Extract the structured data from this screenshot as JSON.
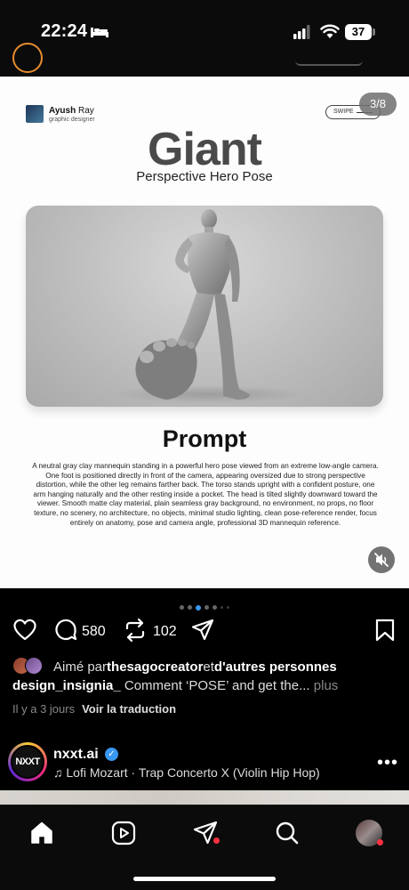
{
  "status_bar": {
    "time": "22:24",
    "battery": "37"
  },
  "slide": {
    "counter": "3/8",
    "author_first": "Ayush",
    "author_last": " Ray",
    "author_role": "graphic designer",
    "swipe_label": "SWIPE",
    "title": "Giant",
    "subtitle": "Perspective Hero Pose",
    "prompt_heading": "Prompt",
    "prompt_text": "A neutral gray clay mannequin standing in a powerful hero pose viewed from an extreme low-angle camera. One foot is positioned directly in front of the camera, appearing oversized due to strong perspective distortion, while the other leg remains farther back. The torso stands upright with a confident posture, one arm hanging naturally and the other resting inside a pocket. The head is tilted slightly downward toward the viewer. Smooth matte clay material, plain seamless gray background, no environment, no props, no floor texture, no scenery, no architecture, no objects, minimal studio lighting, clean pose-reference render, focus entirely on anatomy, pose and camera angle, professional 3D mannequin reference."
  },
  "carousel": {
    "total_dots": 7,
    "active_index": 2
  },
  "actions": {
    "comments": "580",
    "reposts": "102"
  },
  "likes": {
    "prefix": "Aimé par ",
    "user": "thesagocreator",
    "middle": " et ",
    "others": "d'autres personnes"
  },
  "caption": {
    "user": "design_insignia_",
    "text": " Comment ‘POSE’ and get the...",
    "more": "plus"
  },
  "meta": {
    "time_ago": "Il y a 3 jours",
    "translate": "Voir la traduction"
  },
  "next_post": {
    "avatar_text": "NXXT",
    "username": "nxxt.ai",
    "verified_mark": "✓",
    "music": "Lofi Mozart · Trap Concerto X (Violin Hip Hop)",
    "more_icon": "•••"
  },
  "colors": {
    "verified": "#3897f0",
    "notification": "#ff3040",
    "dot_active": "#3897f0"
  }
}
